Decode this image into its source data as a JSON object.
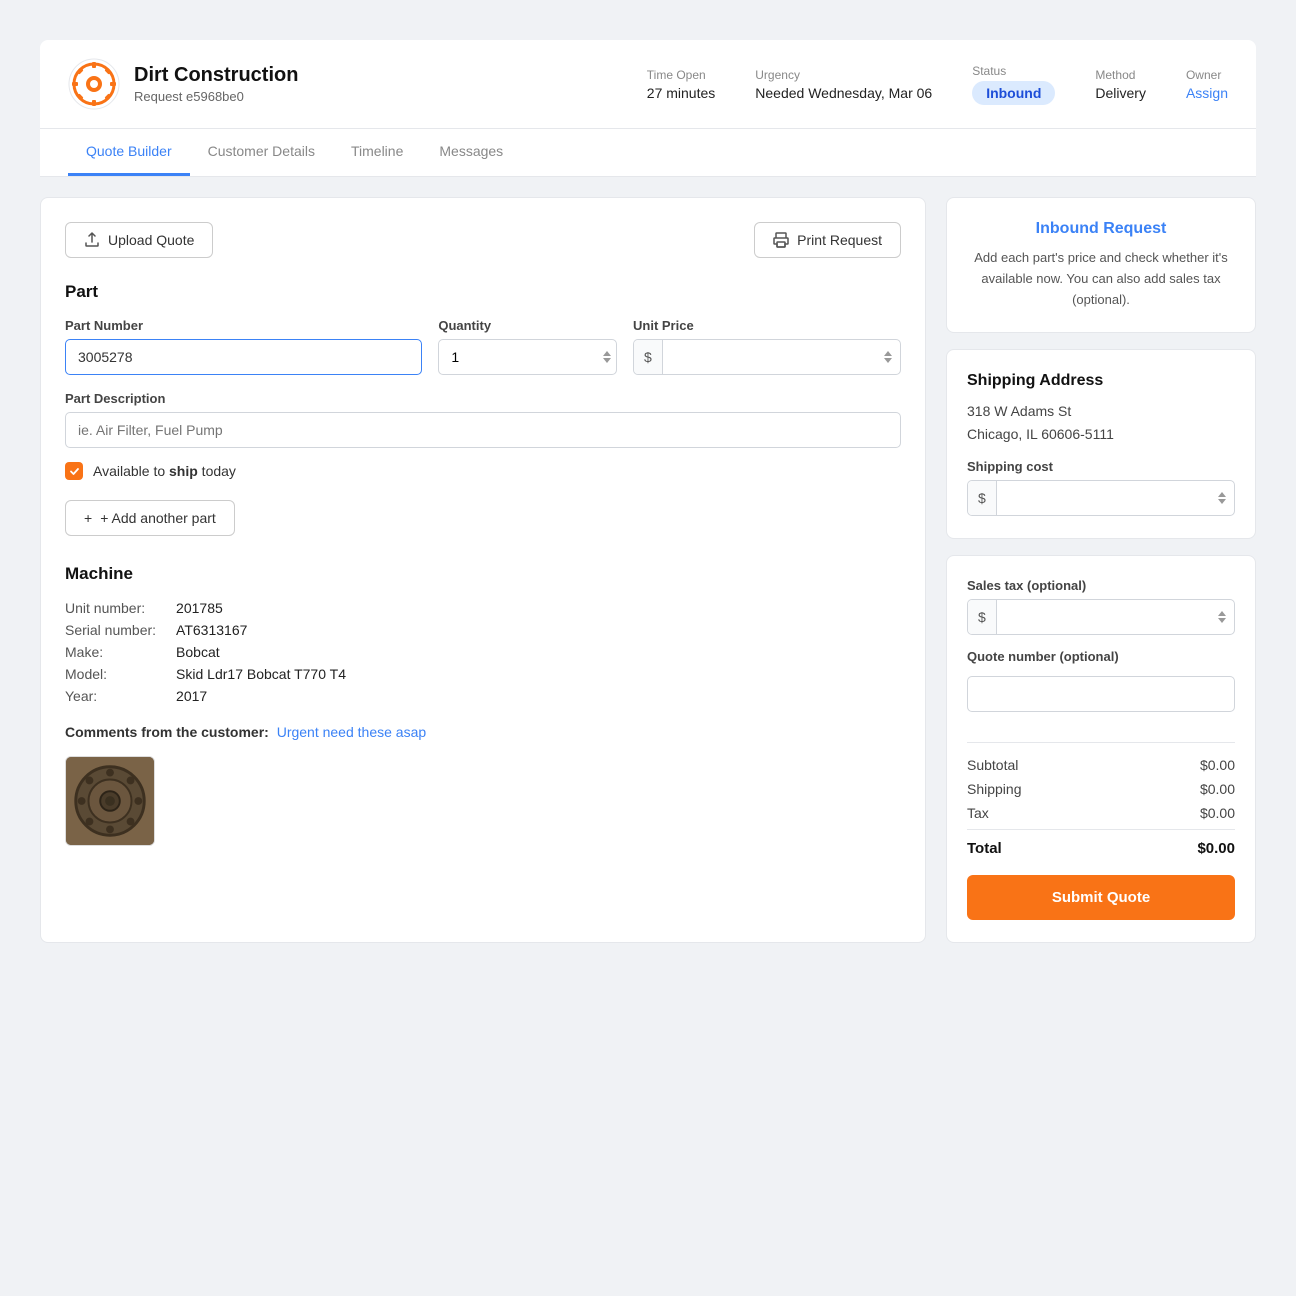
{
  "header": {
    "company_name": "Dirt Construction",
    "request_id": "Request e5968be0",
    "time_open_label": "Time Open",
    "time_open_value": "27 minutes",
    "urgency_label": "Urgency",
    "urgency_value": "Needed Wednesday, Mar 06",
    "status_label": "Status",
    "status_value": "Inbound",
    "method_label": "Method",
    "method_value": "Delivery",
    "owner_label": "Owner",
    "owner_value": "Assign"
  },
  "tabs": [
    {
      "label": "Quote Builder",
      "active": true
    },
    {
      "label": "Customer Details",
      "active": false
    },
    {
      "label": "Timeline",
      "active": false
    },
    {
      "label": "Messages",
      "active": false
    }
  ],
  "actions": {
    "upload_quote": "Upload Quote",
    "print_request": "Print Request"
  },
  "part_section": {
    "title": "Part",
    "part_number_label": "Part Number",
    "part_number_value": "3005278",
    "quantity_label": "Quantity",
    "quantity_value": "1",
    "unit_price_label": "Unit Price",
    "unit_price_prefix": "$",
    "unit_price_value": "",
    "part_description_label": "Part Description",
    "part_description_placeholder": "ie. Air Filter, Fuel Pump",
    "availability_text_before": "Available to ",
    "availability_bold": "ship",
    "availability_text_after": " today"
  },
  "add_part_label": "+ Add another part",
  "machine_section": {
    "title": "Machine",
    "unit_number_label": "Unit number:",
    "unit_number_value": "201785",
    "serial_number_label": "Serial number:",
    "serial_number_value": "AT6313167",
    "make_label": "Make:",
    "make_value": "Bobcat",
    "model_label": "Model:",
    "model_value": "Skid Ldr17 Bobcat T770 T4",
    "year_label": "Year:",
    "year_value": "2017"
  },
  "comments": {
    "label": "Comments from the customer:",
    "text": "Urgent need these asap"
  },
  "right_panel": {
    "inbound_title": "Inbound Request",
    "inbound_desc": "Add each part's price and check whether it's available now. You can also add sales tax (optional).",
    "shipping_address_title": "Shipping Address",
    "shipping_address_line1": "318 W Adams St",
    "shipping_address_line2": "Chicago, IL 60606-5111",
    "shipping_cost_label": "Shipping cost",
    "shipping_cost_prefix": "$",
    "sales_tax_label": "Sales tax (optional)",
    "sales_tax_prefix": "$",
    "quote_number_label": "Quote number (optional)",
    "subtotal_label": "Subtotal",
    "subtotal_value": "$0.00",
    "shipping_label": "Shipping",
    "shipping_value": "$0.00",
    "tax_label": "Tax",
    "tax_value": "$0.00",
    "total_label": "Total",
    "total_value": "$0.00",
    "submit_label": "Submit Quote"
  }
}
